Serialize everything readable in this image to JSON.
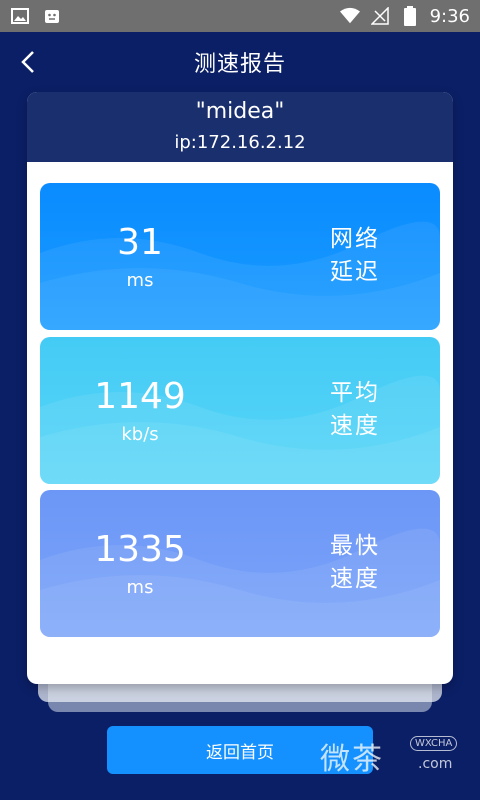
{
  "status_bar": {
    "time": "9:36",
    "icons": [
      "image-icon",
      "android-debug-icon",
      "wifi-icon",
      "signal-icon",
      "battery-icon"
    ]
  },
  "header": {
    "title": "测速报告"
  },
  "network": {
    "ssid": "\"midea\"",
    "ip": "ip:172.16.2.12"
  },
  "metrics": [
    {
      "value": "31",
      "unit": "ms",
      "label_line1": "网络",
      "label_line2": "延迟",
      "color_top": "#0d8dff",
      "color_bottom": "#1ea0ff"
    },
    {
      "value": "1149",
      "unit": "kb/s",
      "label_line1": "平均",
      "label_line2": "速度",
      "color_top": "#47cdf5",
      "color_bottom": "#5ad6f8"
    },
    {
      "value": "1335",
      "unit": "ms",
      "label_line1": "最快",
      "label_line2": "速度",
      "color_top": "#6e99f6",
      "color_bottom": "#7aa3f8"
    }
  ],
  "footer": {
    "home_button": "返回首页"
  },
  "watermark": {
    "text": "微茶",
    "badge": "WXCHA",
    "domain": ".com"
  },
  "colors": {
    "background": "#0b1f66",
    "card_header": "#1a2f6e",
    "button": "#1591ff"
  }
}
